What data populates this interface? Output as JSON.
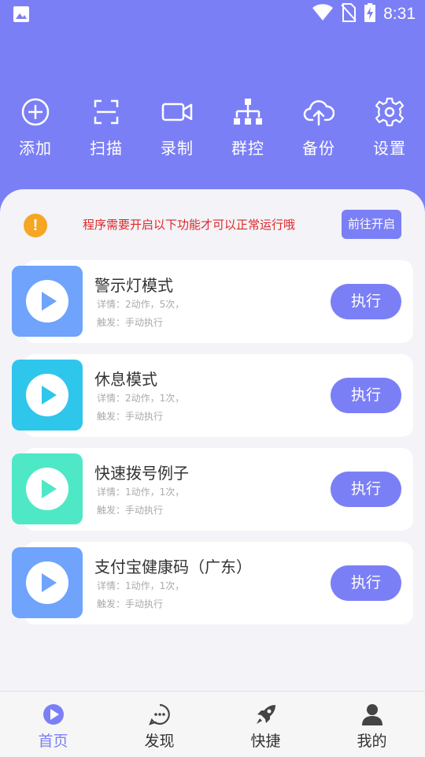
{
  "status_bar": {
    "time": "8:31",
    "icons": [
      "image-icon",
      "wifi-icon",
      "no-sim-icon",
      "battery-charging-icon"
    ]
  },
  "colors": {
    "primary": "#7b7ff6",
    "warning_text": "#e02828",
    "warning_icon": "#f5a623",
    "background": "#f3f3f8"
  },
  "toolbar": {
    "items": [
      {
        "label": "添加",
        "icon": "plus-circle-icon"
      },
      {
        "label": "扫描",
        "icon": "scan-icon"
      },
      {
        "label": "录制",
        "icon": "video-camera-icon"
      },
      {
        "label": "群控",
        "icon": "hierarchy-icon"
      },
      {
        "label": "备份",
        "icon": "cloud-upload-icon"
      },
      {
        "label": "设置",
        "icon": "gear-icon"
      }
    ]
  },
  "notice": {
    "icon": "exclamation-icon",
    "text": "程序需要开启以下功能才可以正常运行哦",
    "button": "前往开启"
  },
  "tasks": [
    {
      "title": "警示灯模式",
      "detail": "详情：2动作，5次，",
      "trigger": "触发：手动执行",
      "button": "执行",
      "thumb_color": "#6fa3fc"
    },
    {
      "title": "休息模式",
      "detail": "详情：2动作，1次，",
      "trigger": "触发：手动执行",
      "button": "执行",
      "thumb_color": "#2fc6ec"
    },
    {
      "title": "快速拨号例子",
      "detail": "详情：1动作，1次，",
      "trigger": "触发：手动执行",
      "button": "执行",
      "thumb_color": "#4ee8c6"
    },
    {
      "title": "支付宝健康码（广东）",
      "detail": "详情：1动作，1次，",
      "trigger": "触发：手动执行",
      "button": "执行",
      "thumb_color": "#6fa3fc"
    }
  ],
  "bottom_nav": {
    "items": [
      {
        "label": "首页",
        "icon": "play-circle-icon",
        "active": true
      },
      {
        "label": "发现",
        "icon": "chat-dots-icon",
        "active": false
      },
      {
        "label": "快捷",
        "icon": "rocket-icon",
        "active": false
      },
      {
        "label": "我的",
        "icon": "person-icon",
        "active": false
      }
    ]
  }
}
